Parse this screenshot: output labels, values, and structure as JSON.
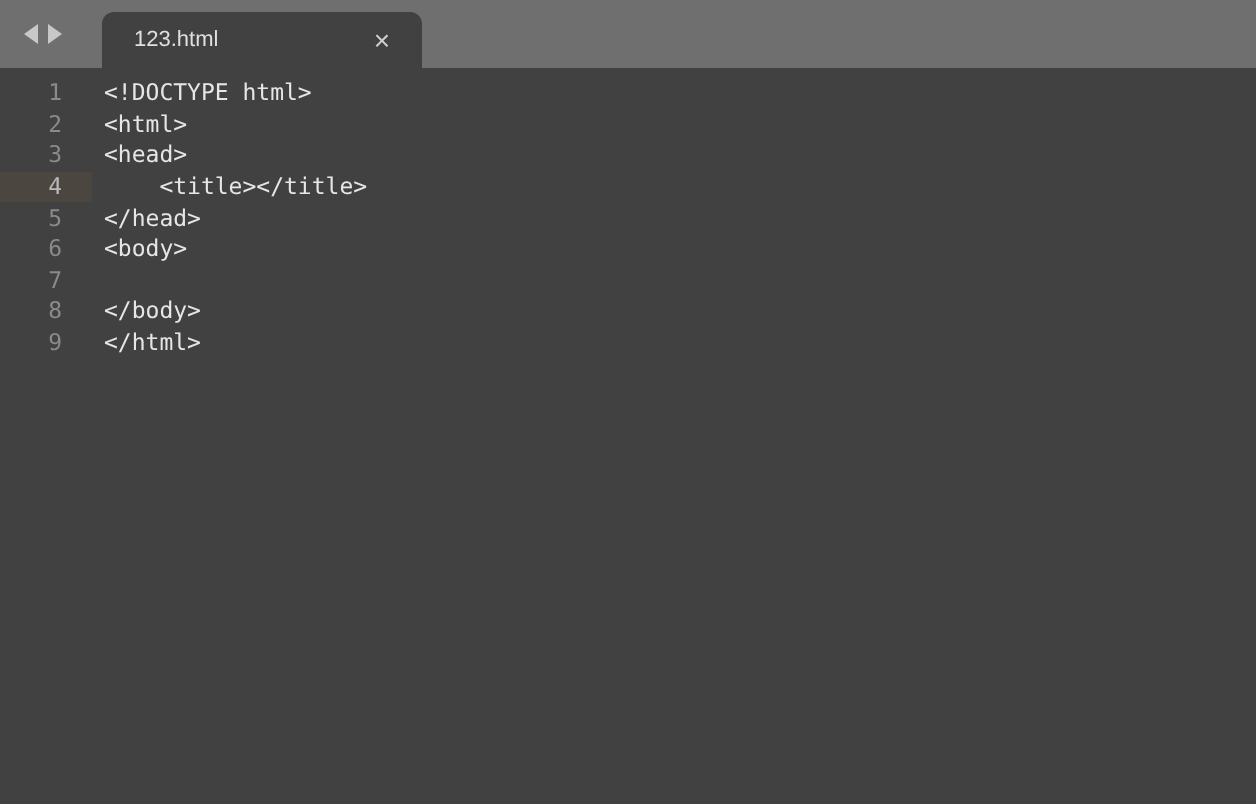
{
  "tabs": [
    {
      "title": "123.html",
      "selected": true,
      "close": "×"
    }
  ],
  "lines": [
    {
      "number": "1",
      "text": "<!DOCTYPE html>",
      "current": false
    },
    {
      "number": "2",
      "text": "<html>",
      "current": false
    },
    {
      "number": "3",
      "text": "<head>",
      "current": false
    },
    {
      "number": "4",
      "text": "    <title></title>",
      "current": true
    },
    {
      "number": "5",
      "text": "</head>",
      "current": false
    },
    {
      "number": "6",
      "text": "<body>",
      "current": false
    },
    {
      "number": "7",
      "current": false
    },
    {
      "number": "8",
      "text": "</body>",
      "current": false
    },
    {
      "number": "9",
      "text": "</html>",
      "current": false
    }
  ]
}
